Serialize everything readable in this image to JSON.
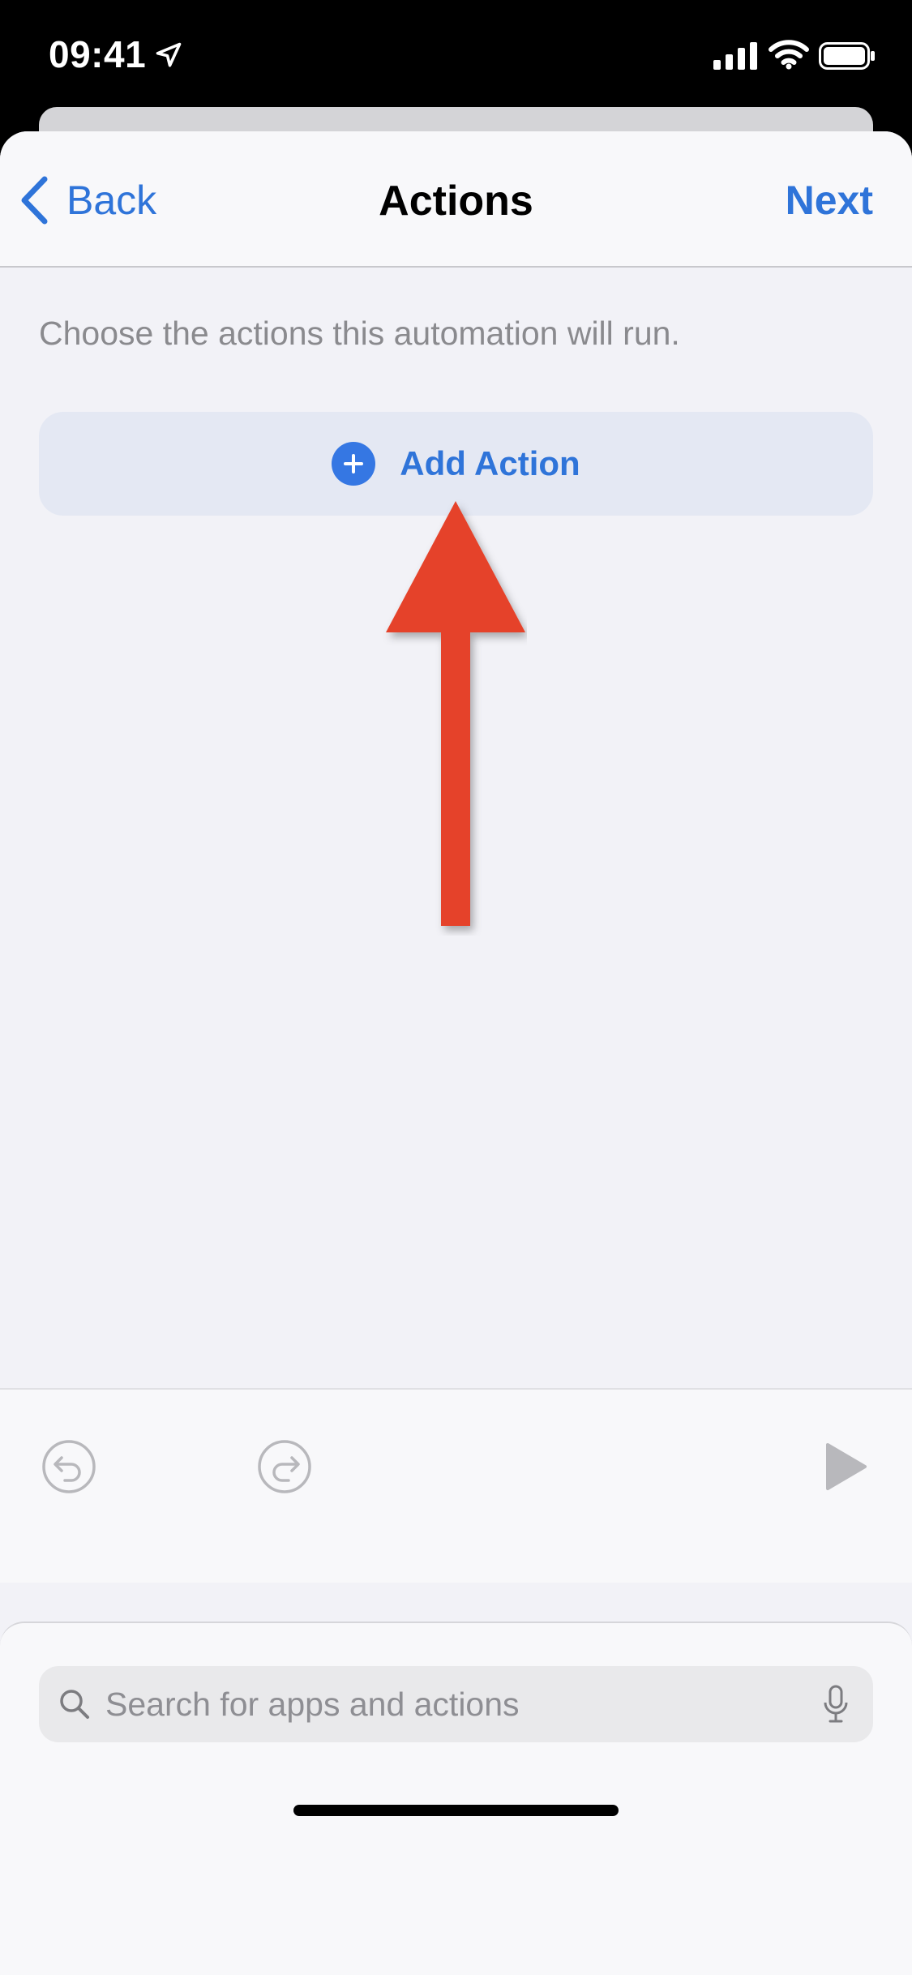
{
  "status_bar": {
    "time": "09:41"
  },
  "nav": {
    "back_label": "Back",
    "title": "Actions",
    "next_label": "Next"
  },
  "main": {
    "subtitle": "Choose the actions this automation will run.",
    "add_action_label": "Add Action"
  },
  "search": {
    "placeholder": "Search for apps and actions"
  },
  "icons": {
    "back": "chevron-left-icon",
    "add": "plus-circle-icon",
    "search": "search-icon",
    "mic": "microphone-icon",
    "undo": "undo-icon",
    "redo": "redo-icon",
    "play": "play-icon",
    "annotation": "red-arrow-up"
  },
  "colors": {
    "accent": "#2f74d9",
    "add_button_bg": "#e4e8f3",
    "annotation_arrow": "#e5432a",
    "background": "#f2f2f7"
  }
}
